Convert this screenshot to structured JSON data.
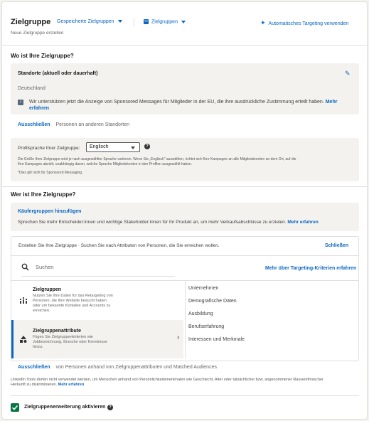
{
  "header": {
    "title": "Zielgruppe",
    "saved_audiences": "Gespeicherte Zielgruppen",
    "audiences": "Zielgruppen",
    "auto_targeting": "Automatisches Targeting verwenden",
    "subtitle": "Neue Zielgruppe erstellen"
  },
  "where": {
    "heading": "Wo ist Ihre Zielgruppe?",
    "locations_label": "Standorte (aktuell oder dauerhaft)",
    "location_value": "Deutschland",
    "eu_notice": "Wir unterstützen jetzt die Anzeige von Sponsored Messages für Mitglieder in der EU, die ihre ausdrückliche Zustimmung erteilt haben.",
    "eu_more_1": "Mehr",
    "eu_more_2": "erfahren",
    "exclude_link": "Ausschließen",
    "exclude_text": "Personen an anderen Standorten",
    "profile_lang_label": "Profilsprache Ihrer Zielgruppe:",
    "profile_lang_value": "Englisch",
    "lang_note_1": "Die Größe Ihrer Zielgruppe wird je nach ausgewählter Sprache variieren. Wenn Sie „Englisch“ auswählen, richtet sich Ihre Kampagne an alle Mitgliedskonten an dem Ort, auf die",
    "lang_note_2": "Ihre Kampagne abzielt, unabhängig davon, welche Sprache Mitgliedskonten in den Profilen ausgewählt haben.",
    "lang_note_3": "*Dies gilt nicht für Sponsored Messaging."
  },
  "who": {
    "heading": "Wer ist Ihre Zielgruppe?",
    "buyer_groups_link": "Käufergruppen hinzufügen",
    "buyer_groups_text": "Sprechen Sie mehr Entscheider:innen und wichtige Stakeholder:innen für Ihr Produkt an, um mehr Verkaufsabschlüsse zu erzielen.",
    "buyer_groups_more": "Mehr erfahren",
    "create_text": "Erstellen Sie Ihre Zielgruppe · Suchen Sie nach Attributen von Personen, die Sie erreichen wollen.",
    "close": "Schließen",
    "search_placeholder": "Suchen",
    "targeting_more": "Mehr über Targeting-Kriterien erfahren",
    "audiences_title": "Zielgruppen",
    "audiences_desc_1": "Nutzen Sie Ihre Daten für das Retargeting von",
    "audiences_desc_2": "Personen, die Ihre Website besucht haben",
    "audiences_desc_3": "oder um bekannte Kontakte und Accounts zu",
    "audiences_desc_4": "erreichen.",
    "attributes_title": "Zielgruppenattribute",
    "attributes_desc_1": "Fügen Sie Zielgruppenkriterien wie",
    "attributes_desc_2": "Jobbezeichnung, Branche oder Kenntnisse",
    "attributes_desc_3": "hinzu.",
    "categories": [
      "Unternehmen",
      "Demografische Daten",
      "Ausbildung",
      "Berufserfahrung",
      "Interessen und Merkmale"
    ],
    "exclude_link": "Ausschließen",
    "exclude_text": "von Personen anhand von Zielgruppenattributen und Matched Audiences",
    "legal_1": "LinkedIn Tools dürfen nicht verwendet werden, um Menschen anhand von Persönlichkeitsmerkmalen wie Geschlecht, Alter oder tatsächlicher bzw. angenommener Rasse/ethnischer",
    "legal_2": "Herkunft zu diskriminieren.",
    "legal_more": "Mehr erfahren",
    "expansion_label": "Zielgruppenerweiterung aktivieren"
  },
  "colors": {
    "brand": "#0a66c2",
    "check": "#057642",
    "active_bar": "#0a66c2"
  }
}
